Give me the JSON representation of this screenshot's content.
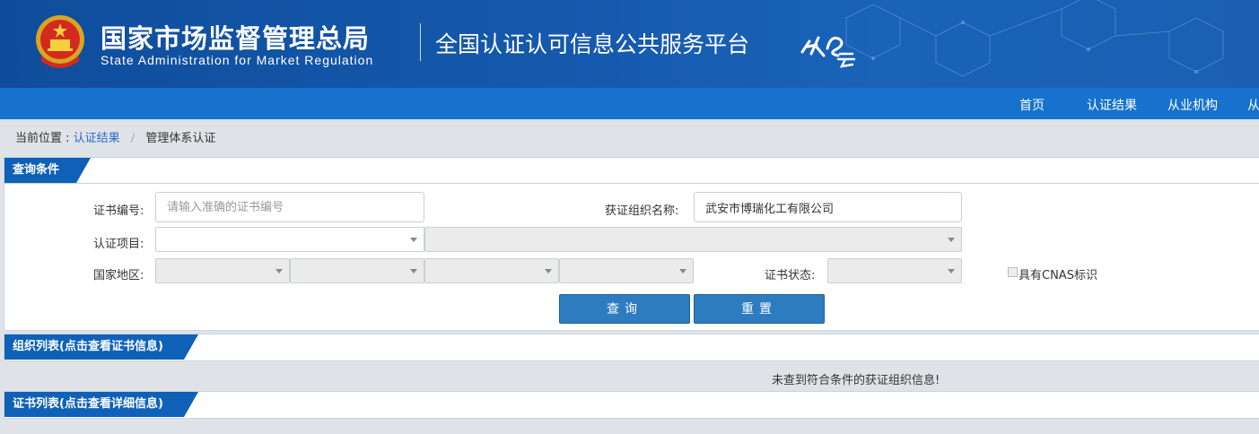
{
  "header": {
    "agency_cn": "国家市场监督管理总局",
    "agency_en": "State Administration  for  Market Regulation",
    "platform_title": "全国认证认可信息公共服务平台",
    "logo_text": "认e云"
  },
  "nav": {
    "items": [
      "首页",
      "认证结果",
      "从业机构",
      "从"
    ]
  },
  "breadcrumb": {
    "prefix": "当前位置 :",
    "link": "认证结果",
    "separator": "/",
    "current": "管理体系认证"
  },
  "query": {
    "title": "查询条件",
    "cert_no_label": "证书编号:",
    "cert_no_placeholder": "请输入准确的证书编号",
    "cert_no_value": "",
    "org_name_label": "获证组织名称:",
    "org_name_value": "武安市博瑞化工有限公司",
    "project_label": "认证项目:",
    "region_label": "国家地区:",
    "status_label": "证书状态:",
    "cnas_label": "具有CNAS标识",
    "search_button": "查询",
    "reset_button": "重置"
  },
  "org_list": {
    "title": "组织列表(点击查看证书信息)",
    "empty_message": "未查到符合条件的获证组织信息!"
  },
  "cert_list": {
    "title": "证书列表(点击查看详细信息)"
  },
  "colors": {
    "header_blue": "#1559ad",
    "nav_blue": "#1672cc",
    "tab_blue": "#0f61b8",
    "button_blue": "#2d7cc0",
    "link_blue": "#2a6cc6"
  }
}
